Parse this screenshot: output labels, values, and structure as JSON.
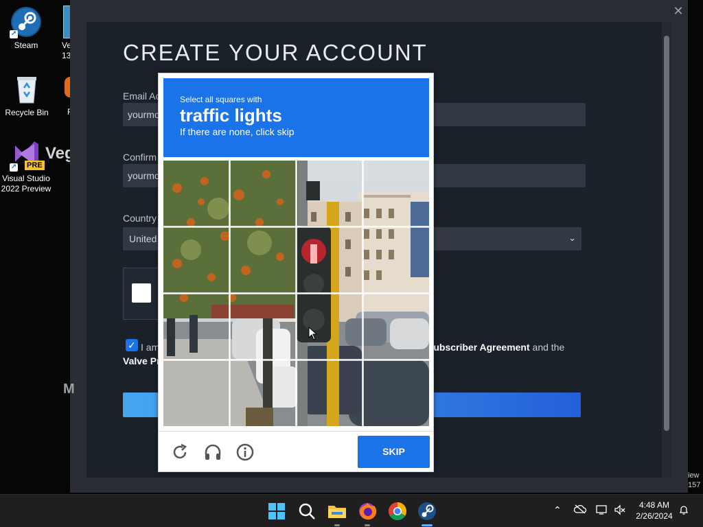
{
  "desktop": {
    "icons": [
      {
        "label": "Steam"
      },
      {
        "label": "Recycle Bin"
      },
      {
        "label": "Visual Studio 2022 Preview",
        "badge": "PRE"
      }
    ],
    "partial_labels": {
      "ve": "Ve",
      "num": "13.0",
      "vegas": "Veg",
      "f": "F"
    }
  },
  "steam_window": {
    "title": "CREATE YOUR ACCOUNT",
    "close_icon": "close-icon",
    "email_label": "Email Ac",
    "email_value": "yourmc",
    "confirm_label": "Confirm",
    "confirm_value": "yourmc",
    "country_label": "Country",
    "country_value": "United",
    "agreement_prefix": "I am",
    "agreement_link1": "Subscriber Agreement",
    "agreement_and": "and the",
    "agreement_link2": "Valve Pr",
    "side_letter": "M"
  },
  "captcha": {
    "line1": "Select all squares with",
    "target": "traffic lights",
    "line3": "If there are none, click skip",
    "skip_label": "SKIP",
    "icons": [
      "reload-icon",
      "audio-icon",
      "info-icon"
    ],
    "accent": "#1a73e8"
  },
  "taskbar": {
    "apps": [
      "start-icon",
      "search-icon",
      "file-explorer-icon",
      "firefox-icon",
      "chrome-icon",
      "steam-icon"
    ],
    "time": "4:48 AM",
    "date": "2/26/2024"
  },
  "peek": {
    "line1": "iew",
    "line2": "157"
  }
}
